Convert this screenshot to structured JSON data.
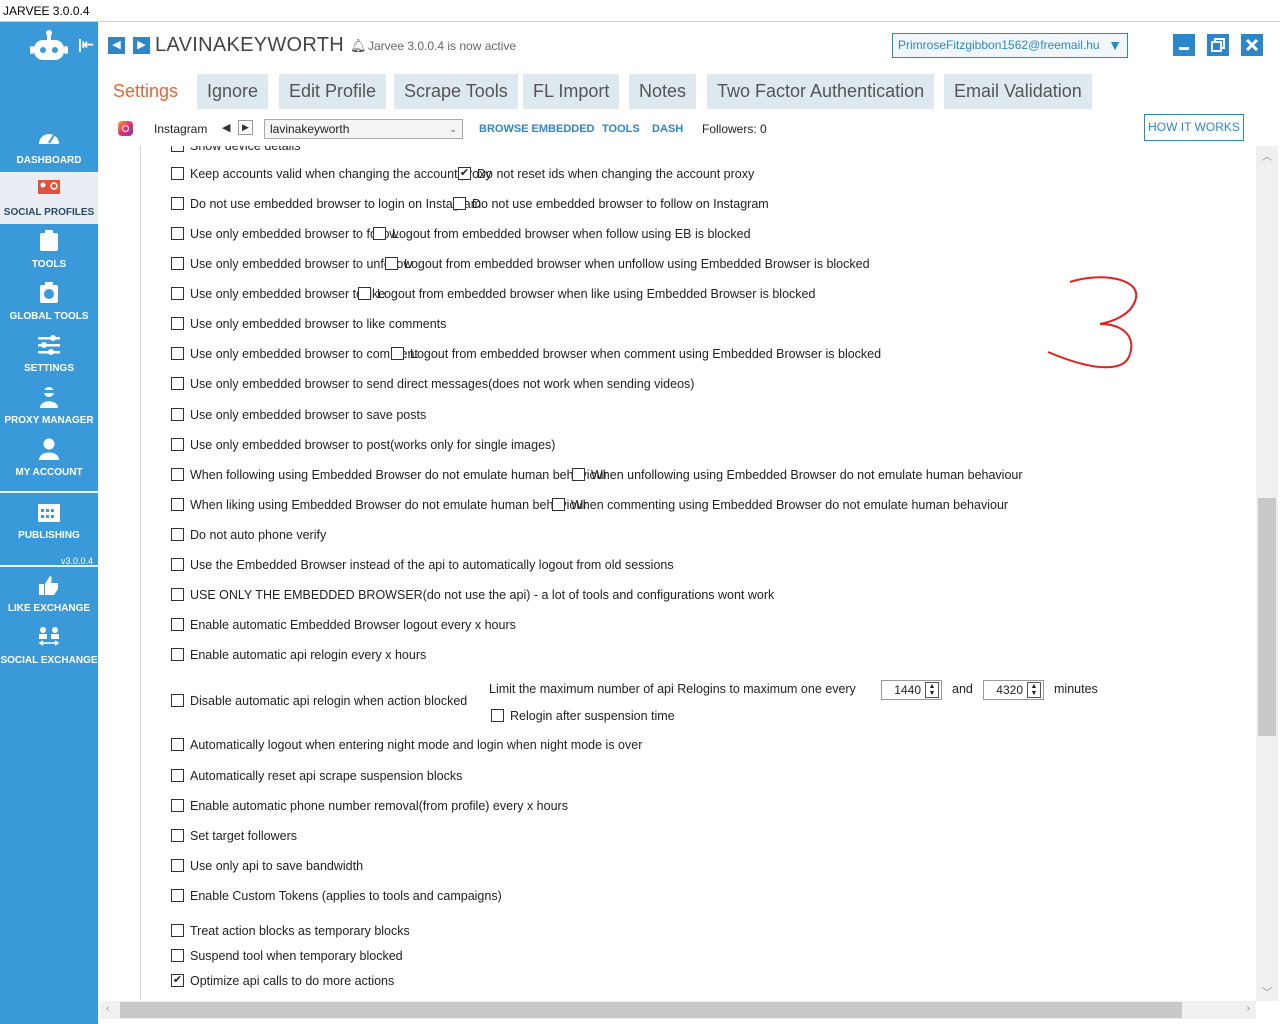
{
  "window": {
    "title": "JARVEE 3.0.0.4"
  },
  "sidebar": {
    "items": [
      {
        "label": "DASHBOARD",
        "icon": "dashboard-icon"
      },
      {
        "label": "SOCIAL PROFILES",
        "icon": "social-profiles-icon",
        "active": true
      },
      {
        "label": "TOOLS",
        "icon": "tools-icon"
      },
      {
        "label": "GLOBAL TOOLS",
        "icon": "global-tools-icon"
      },
      {
        "label": "SETTINGS",
        "icon": "settings-sliders-icon"
      },
      {
        "label": "PROXY MANAGER",
        "icon": "proxy-manager-icon"
      },
      {
        "label": "MY ACCOUNT",
        "icon": "user-icon"
      },
      {
        "label": "PUBLISHING",
        "icon": "calendar-icon"
      },
      {
        "label": "LIKE EXCHANGE",
        "icon": "like-exchange-icon"
      },
      {
        "label": "SOCIAL EXCHANGE",
        "icon": "social-exchange-icon"
      }
    ],
    "version": "v3.0.0.4"
  },
  "header": {
    "account_name": "LAVINAKEYWORTH",
    "status": "Jarvee 3.0.0.4 is now active",
    "email": "PrimroseFitzgibbon1562@freemail.hu"
  },
  "tabs": [
    "Settings",
    "Ignore",
    "Edit Profile",
    "Scrape Tools",
    "FL Import",
    "Notes",
    "Two Factor Authentication",
    "Email Validation"
  ],
  "toolbar": {
    "platform": "Instagram",
    "account_select": "lavinakeyworth",
    "links": [
      "BROWSE EMBEDDED",
      "TOOLS",
      "DASH"
    ],
    "followers": "Followers: 0",
    "how_it_works": "HOW IT WORKS"
  },
  "settings": {
    "partial_top": "Show device details",
    "rows": [
      [
        {
          "label": "Keep accounts valid when changing the account proxy",
          "checked": false
        },
        {
          "label": "Do not reset ids when changing the account proxy",
          "checked": true
        }
      ],
      [
        {
          "label": "Do not use embedded browser to login on Instagram",
          "checked": false
        },
        {
          "label": "Do not use embedded browser to follow on Instagram",
          "checked": false
        }
      ],
      [
        {
          "label": "Use only embedded browser to follow",
          "checked": false
        },
        {
          "label": "Logout from embedded browser when follow using EB is blocked",
          "checked": false
        }
      ],
      [
        {
          "label": "Use only embedded browser to unfollow",
          "checked": false
        },
        {
          "label": "Logout from embedded browser when unfollow using Embedded Browser is blocked",
          "checked": false
        }
      ],
      [
        {
          "label": "Use only embedded browser to like",
          "checked": false
        },
        {
          "label": "Logout from embedded browser when like using Embedded Browser is blocked",
          "checked": false
        }
      ],
      [
        {
          "label": "Use only embedded browser to like comments",
          "checked": false
        }
      ],
      [
        {
          "label": "Use only embedded browser to comment",
          "checked": false
        },
        {
          "label": "Logout from embedded browser when comment using Embedded Browser is blocked",
          "checked": false
        }
      ],
      [
        {
          "label": "Use only embedded browser to send direct messages(does not work when sending videos)",
          "checked": false
        }
      ],
      [
        {
          "label": "Use only embedded browser to save posts",
          "checked": false
        }
      ],
      [
        {
          "label": "Use only embedded browser to post(works only for single images)",
          "checked": false
        }
      ],
      [
        {
          "label": "When following using Embedded Browser do not emulate human behaviour",
          "checked": false
        },
        {
          "label": "When unfollowing using Embedded Browser do not emulate human behaviour",
          "checked": false
        }
      ],
      [
        {
          "label": "When liking using Embedded Browser do not emulate human behaviour",
          "checked": false
        },
        {
          "label": "When commenting using Embedded Browser do not emulate human behaviour",
          "checked": false
        }
      ],
      [
        {
          "label": "Do not auto phone verify",
          "checked": false
        }
      ],
      [
        {
          "label": "Use the Embedded Browser instead of the api to automatically logout from old sessions",
          "checked": false
        }
      ],
      [
        {
          "label": "USE ONLY THE EMBEDDED BROWSER(do not use the api) - a lot of tools and configurations wont work",
          "checked": false
        }
      ],
      [
        {
          "label": "Enable automatic Embedded Browser logout every x hours",
          "checked": false
        }
      ],
      [
        {
          "label": "Enable automatic api relogin every x hours",
          "checked": false
        }
      ]
    ],
    "relogin": {
      "disable_label": "Disable automatic api relogin when action blocked",
      "limit_label": "Limit the maximum number of api Relogins to maximum one every",
      "min_value": "1440",
      "and_label": "and",
      "max_value": "4320",
      "minutes_label": "minutes",
      "after_suspension_label": "Relogin after suspension time"
    },
    "rows_bottom": [
      {
        "label": "Automatically logout when entering night mode and login when night mode is over",
        "checked": false
      },
      {
        "label": "Automatically reset api scrape suspension blocks",
        "checked": false
      },
      {
        "label": "Enable automatic phone number removal(from profile) every x hours",
        "checked": false
      },
      {
        "label": "Set target followers",
        "checked": false
      },
      {
        "label": "Use only api to save bandwidth",
        "checked": false
      },
      {
        "label": "Enable Custom Tokens (applies to tools and campaigns)",
        "checked": false
      },
      {
        "label": "Treat action blocks as temporary blocks",
        "checked": false
      },
      {
        "label": "Suspend tool when temporary blocked",
        "checked": false
      },
      {
        "label": "Optimize api calls to do more actions",
        "checked": true
      }
    ]
  },
  "colors": {
    "sidebar": "#3a9ad9",
    "accent": "#2d86c7",
    "active_tab": "#e2663a",
    "tab_bg": "#dde9ee",
    "annotation": "#e02020"
  }
}
